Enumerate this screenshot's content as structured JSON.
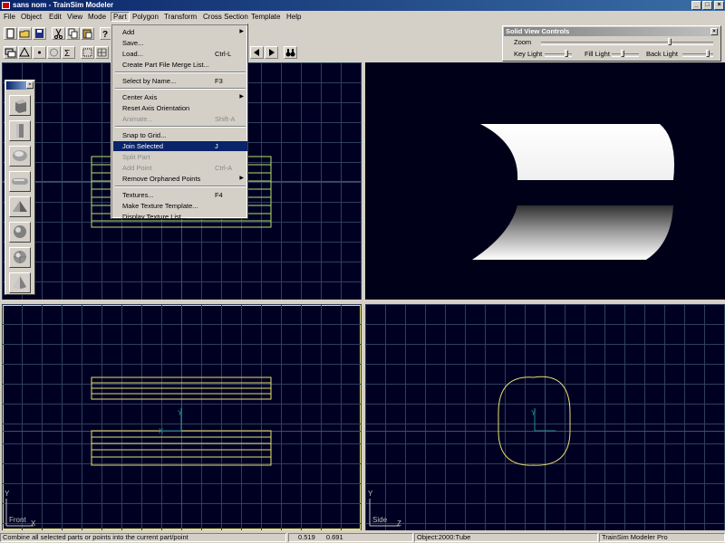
{
  "window": {
    "title": "sans nom - TrainSim Modeler",
    "controls": {
      "minimize": "_",
      "maximize": "□",
      "close": "×"
    }
  },
  "menubar": [
    "File",
    "Object",
    "Edit",
    "View",
    "Mode",
    "Part",
    "Polygon",
    "Transform",
    "Cross Section",
    "Template",
    "Help"
  ],
  "menubar_active": "Part",
  "part_menu": {
    "items": [
      {
        "label": "Add",
        "shortcut": "",
        "submenu": true,
        "disabled": false,
        "highlighted": false
      },
      {
        "label": "Save...",
        "shortcut": "",
        "submenu": false,
        "disabled": false,
        "highlighted": false
      },
      {
        "label": "Load...",
        "shortcut": "Ctrl-L",
        "submenu": false,
        "disabled": false,
        "highlighted": false
      },
      {
        "label": "Create Part File Merge List...",
        "shortcut": "",
        "submenu": false,
        "disabled": false,
        "highlighted": false
      },
      {
        "label": "Select by Name...",
        "shortcut": "F3",
        "submenu": false,
        "disabled": false,
        "highlighted": false
      },
      {
        "label": "Center Axis",
        "shortcut": "",
        "submenu": true,
        "disabled": false,
        "highlighted": false
      },
      {
        "label": "Reset Axis Orientation",
        "shortcut": "",
        "submenu": false,
        "disabled": false,
        "highlighted": false
      },
      {
        "label": "Animate...",
        "shortcut": "Shift-A",
        "submenu": false,
        "disabled": true,
        "highlighted": false
      },
      {
        "label": "Snap to Grid...",
        "shortcut": "",
        "submenu": false,
        "disabled": false,
        "highlighted": false
      },
      {
        "label": "Join Selected",
        "shortcut": "J",
        "submenu": false,
        "disabled": false,
        "highlighted": true
      },
      {
        "label": "Split Part",
        "shortcut": "",
        "submenu": false,
        "disabled": true,
        "highlighted": false
      },
      {
        "label": "Add Point",
        "shortcut": "Ctrl-A",
        "submenu": false,
        "disabled": true,
        "highlighted": false
      },
      {
        "label": "Remove Orphaned Points",
        "shortcut": "",
        "submenu": true,
        "disabled": false,
        "highlighted": false
      },
      {
        "label": "Textures...",
        "shortcut": "F4",
        "submenu": false,
        "disabled": false,
        "highlighted": false
      },
      {
        "label": "Make Texture Template...",
        "shortcut": "",
        "submenu": false,
        "disabled": false,
        "highlighted": false
      },
      {
        "label": "Display Texture List...",
        "shortcut": "",
        "submenu": false,
        "disabled": false,
        "highlighted": false
      }
    ]
  },
  "solid_view_controls": {
    "title": "Solid View Controls",
    "close": "×",
    "zoom_label": "Zoom",
    "key_light_label": "Key Light",
    "fill_light_label": "Fill Light",
    "back_light_label": "Back Light",
    "zoom_value": 0.75,
    "key_light_value": 0.85,
    "fill_light_value": 0.4,
    "back_light_value": 0.85
  },
  "viewports": {
    "front_label": "Front",
    "side_label": "Side",
    "front_axes": {
      "y": "Y",
      "x": "X"
    },
    "side_axes": {
      "y": "Y",
      "z": "Z"
    }
  },
  "palette": {
    "close": "×",
    "shapes": [
      "cube-icon",
      "cylinder-icon",
      "disc-icon",
      "capsule-icon",
      "pyramid-icon",
      "sphere-icon",
      "sphere-faceted-icon",
      "cone-icon"
    ]
  },
  "statusbar": {
    "message": "Combine all selected parts or points into the current part/point",
    "coord_x": "0.519",
    "coord_y": "0.691",
    "object": "Object:2000:Tube",
    "product": "TrainSim Modeler Pro"
  },
  "colors": {
    "viewport_bg": "#000022",
    "wire": "#b8e070",
    "grid": "#2e3f5c",
    "highlight": "#0a246a"
  }
}
